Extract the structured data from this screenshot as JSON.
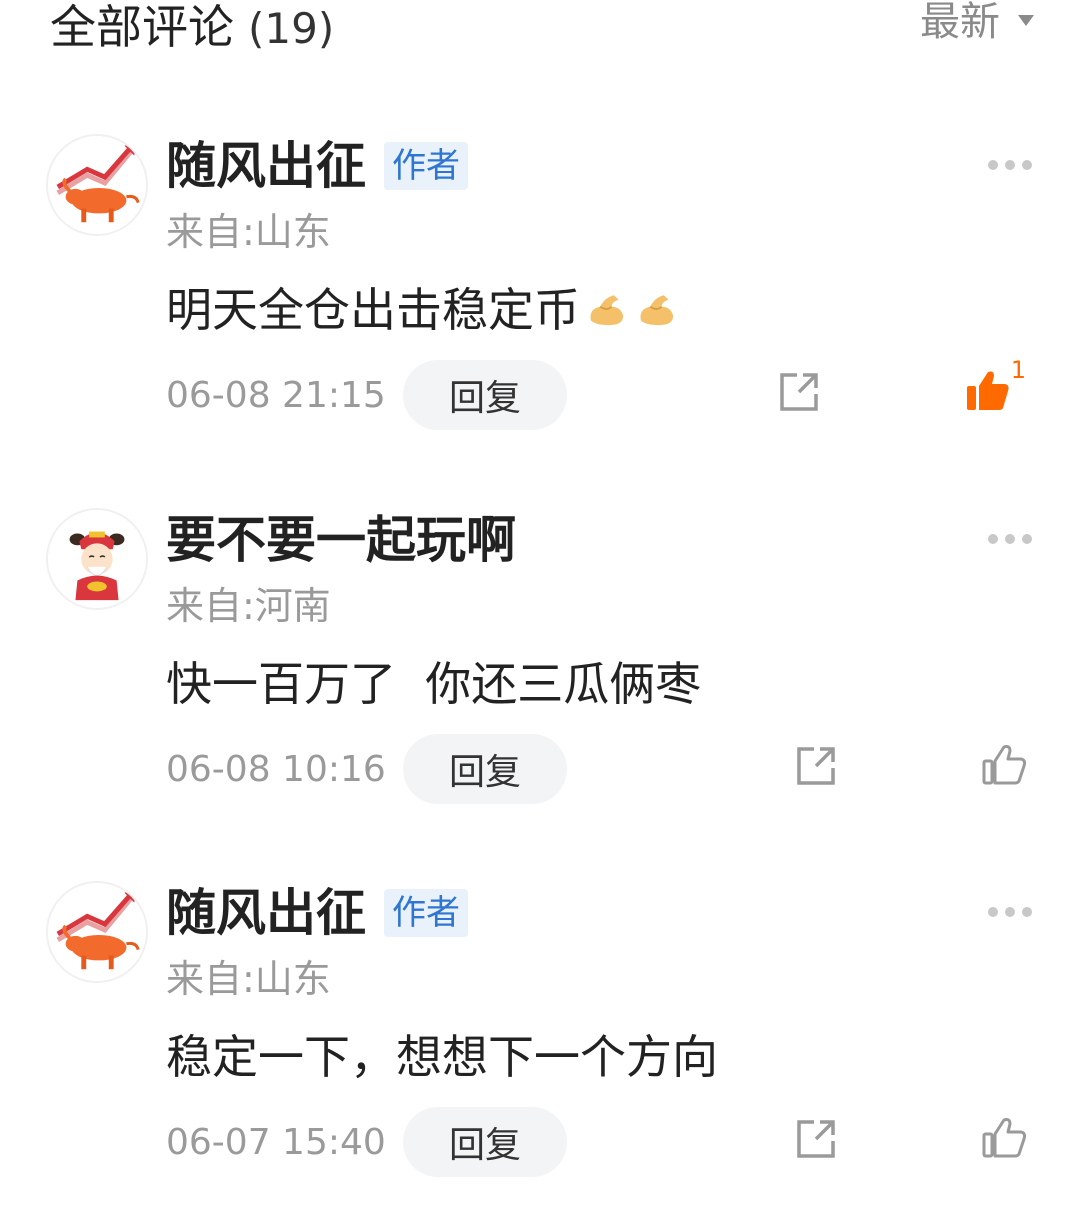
{
  "header": {
    "title": "全部评论",
    "count": "(19)",
    "sort_label": "最新"
  },
  "comments": [
    {
      "user": "随风出征",
      "badge": "作者",
      "location": "来自:山东",
      "text": "明天全仓出击稳定币",
      "emojis": [
        "flexed-biceps",
        "flexed-biceps"
      ],
      "time": "06-08 21:15",
      "reply_label": "回复",
      "likes": "1",
      "liked": true
    },
    {
      "user": "要不要一起玩啊",
      "badge": "",
      "location": "来自:河南",
      "text": "快一百万了  你还三瓜俩枣",
      "time": "06-08 10:16",
      "reply_label": "回复",
      "likes": "",
      "liked": false
    },
    {
      "user": "随风出征",
      "badge": "作者",
      "location": "来自:山东",
      "text": "稳定一下，想想下一个方向",
      "time": "06-07 15:40",
      "reply_label": "回复",
      "likes": "",
      "liked": false
    }
  ],
  "colors": {
    "badge_text": "#2f76d2",
    "badge_bg": "#e9f1fb",
    "like_active": "#ff6a00",
    "muted_text": "#9a9a9a"
  },
  "icons": {
    "sort": "caret-down-icon",
    "more": "more-dots-icon",
    "share": "share-icon",
    "like": "thumbs-up-icon",
    "avatar_bull": "bull-avatar",
    "avatar_fortune": "fortune-god-avatar"
  }
}
